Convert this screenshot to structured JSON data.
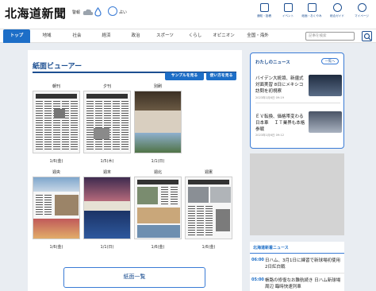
{
  "header": {
    "logo": "北海道新聞",
    "weather_label": "警報",
    "fortune_label": "占い",
    "nav_items": [
      {
        "label": "通知・投稿",
        "icon": "megaphone-icon"
      },
      {
        "label": "イベント",
        "icon": "calendar-icon"
      },
      {
        "label": "紙面・おくやみ",
        "icon": "newspaper-icon"
      },
      {
        "label": "総合ガイド",
        "icon": "help-icon"
      },
      {
        "label": "マイページ",
        "icon": "user-icon"
      }
    ]
  },
  "nav": {
    "tabs": [
      "トップ",
      "地域",
      "社会",
      "経済",
      "政治",
      "スポーツ",
      "くらし",
      "オピニオン",
      "全国・海外"
    ],
    "search_placeholder": "記事を検索"
  },
  "viewer": {
    "title": "紙面ビューアー",
    "sample_button": "サンプルを見る",
    "howto_button": "使い方を見る",
    "papers": [
      {
        "label": "朝刊",
        "date": "1/6(金)"
      },
      {
        "label": "夕刊",
        "date": "1/5(木)"
      },
      {
        "label": "別刷",
        "date": "1/1(日)"
      },
      {
        "label": "週央",
        "date": "1/6(金)"
      },
      {
        "label": "週末",
        "date": "1/1(日)"
      },
      {
        "label": "週北",
        "date": "1/6(金)"
      },
      {
        "label": "週憲",
        "date": "1/6(金)"
      }
    ],
    "list_button": "紙面一覧"
  },
  "sidebar": {
    "news_heading": "わたしのニュース",
    "more_label": "一覧へ",
    "items": [
      {
        "title": "バイデン大統領、新疆式対面実習 8日にメキシコ訪問を初視察",
        "time": "2023年1月6日 09:19"
      },
      {
        "title": "ＥＶ転換、価格帯変わる日本車 　ＩＴ業界も本格参戦",
        "time": "2023年1月6日 09:12"
      }
    ],
    "latest_heading": "北海道新着ニュース",
    "latest": [
      {
        "time": "06:00",
        "text": "日ハム、3月1日に練習で新球場初使用 2日紅白戦"
      },
      {
        "time": "05:00",
        "text": "帳路の修復なお難航続き 日ハム新球場周辺 臨時快速列車"
      }
    ]
  },
  "colors": {
    "accent": "#1d6ec7",
    "navy": "#1d4f91",
    "background": "#e9edf2"
  }
}
